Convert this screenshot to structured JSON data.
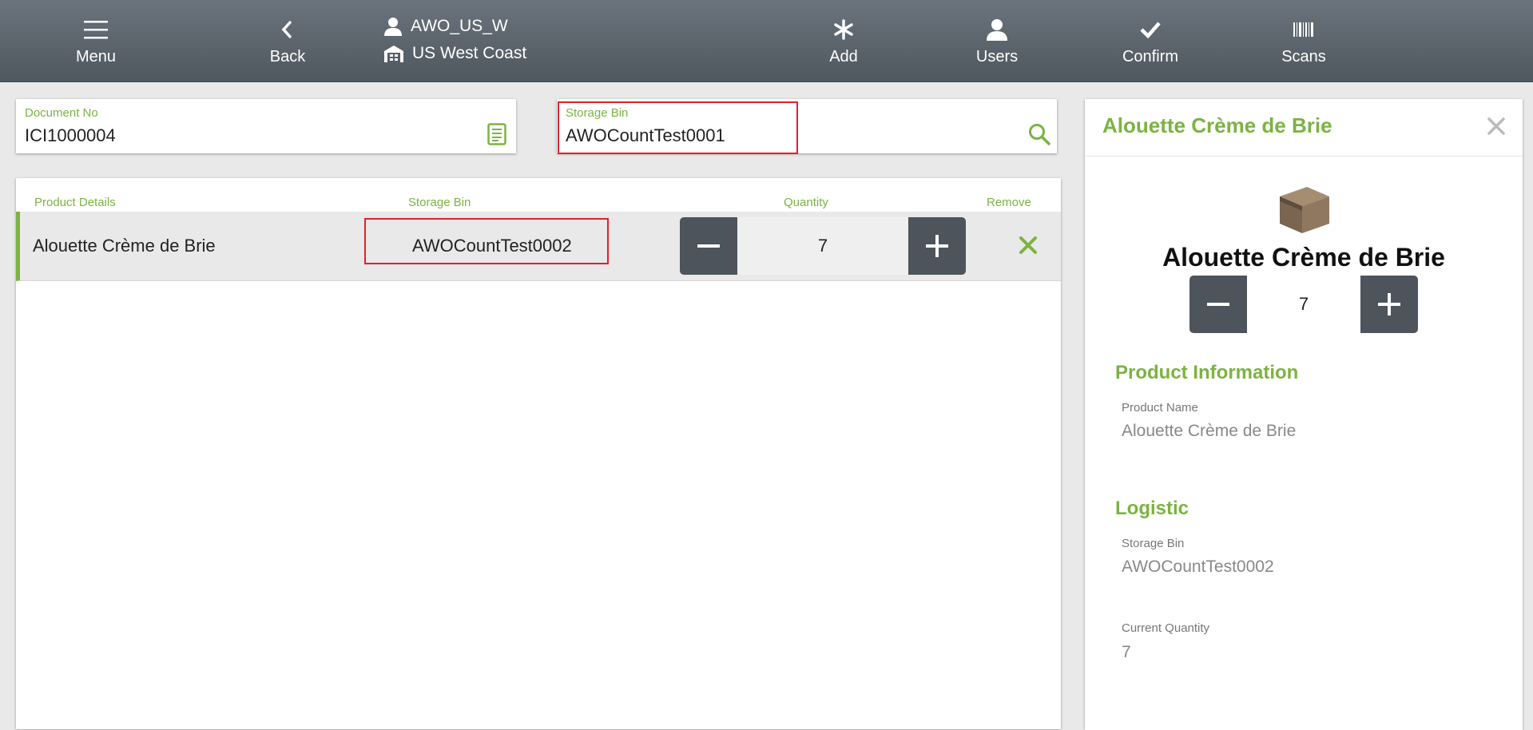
{
  "header": {
    "menu_label": "Menu",
    "back_label": "Back",
    "user_name": "AWO_US_W",
    "warehouse_name": "US West Coast",
    "add_label": "Add",
    "users_label": "Users",
    "confirm_label": "Confirm",
    "scans_label": "Scans"
  },
  "document": {
    "label": "Document No",
    "value": "ICI1000004"
  },
  "storage_bin_search": {
    "label": "Storage Bin",
    "value": "AWOCountTest0001"
  },
  "table": {
    "headers": {
      "product": "Product Details",
      "bin": "Storage Bin",
      "quantity": "Quantity",
      "remove": "Remove"
    },
    "rows": [
      {
        "product": "Alouette Crème de Brie",
        "bin": "AWOCountTest0002",
        "quantity": "7"
      }
    ]
  },
  "detail": {
    "header_title": "Alouette Crème de Brie",
    "product_title": "Alouette Crème de Brie",
    "quantity": "7",
    "product_info_title": "Product Information",
    "product_name_label": "Product Name",
    "product_name_value": "Alouette Crème de Brie",
    "logistic_title": "Logistic",
    "storage_bin_label": "Storage Bin",
    "storage_bin_value": "AWOCountTest0002",
    "current_qty_label": "Current Quantity",
    "current_qty_value": "7"
  },
  "colors": {
    "accent": "#7cb342",
    "highlight": "#e0212a",
    "button_dark": "#4d545b"
  }
}
